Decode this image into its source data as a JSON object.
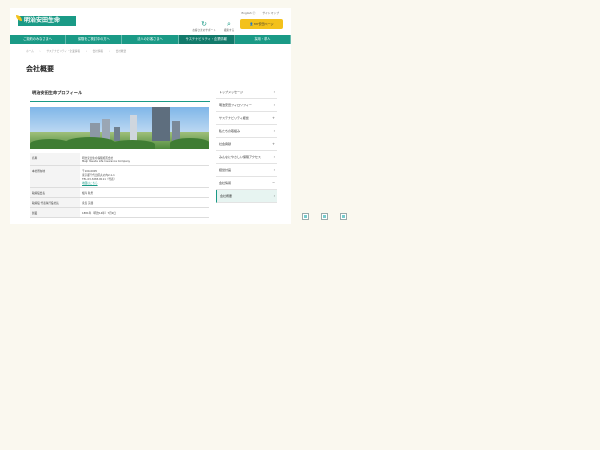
{
  "header": {
    "logo_text": "明治安田生命",
    "icon_buttons": [
      {
        "icon": "refresh-icon",
        "label": "お客さまのサポート"
      },
      {
        "icon": "search-icon",
        "label": "検索する"
      }
    ],
    "top_links": [
      "English ⓔ",
      "サイトマップ"
    ],
    "cta_label": "👤 MY安田ページ"
  },
  "nav": {
    "items": [
      "ご契約のみなさまへ",
      "保険をご検討中の方へ",
      "法人のお客さまへ",
      "サステナビリティ・企業情報",
      "採用・求人"
    ],
    "active_index": 3
  },
  "breadcrumb": [
    "ホーム",
    "サステナビリティ・企業情報",
    "会社情報",
    "会社概要"
  ],
  "page_title": "会社概要",
  "section": {
    "title": "明治安田生命プロフィール"
  },
  "info_table": [
    {
      "key": "名称",
      "lines": [
        "明治安田生命保険相互会社",
        "Meiji Yasuda Life Insurance Company"
      ]
    },
    {
      "key": "本社所在地",
      "lines": [
        "〒100-0005",
        "東京都千代田区丸の内2-1-1",
        "TEL.03-3283-8111（代表）"
      ],
      "link": "地図はこちら"
    },
    {
      "key": "取締役会長",
      "lines": [
        "根岸 秋男"
      ]
    },
    {
      "key": "取締役 代表執行役社長",
      "lines": [
        "永島 英器"
      ]
    },
    {
      "key": "創業",
      "lines": [
        "1881年（明治14年）7月9日"
      ]
    }
  ],
  "sidebar": {
    "items": [
      {
        "label": "トップメッセージ",
        "marker": "›"
      },
      {
        "label": "明治安田フィロソフィー",
        "marker": "›"
      },
      {
        "label": "サステナビリティ経営",
        "marker": "+"
      },
      {
        "label": "私たちの取組み",
        "marker": "›"
      },
      {
        "label": "社会貢献",
        "marker": "+"
      },
      {
        "label": "みんなにやさしい保険アクセス",
        "marker": "›"
      },
      {
        "label": "経営計画",
        "marker": "›"
      },
      {
        "label": "会社情報",
        "marker": "−"
      },
      {
        "label": "会社概要",
        "marker": "›",
        "current": true
      }
    ]
  }
}
